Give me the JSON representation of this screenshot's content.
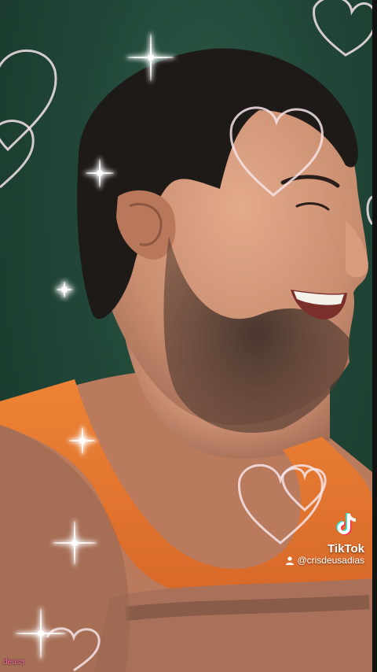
{
  "watermark": {
    "brand": "TikTok",
    "handle": "@crisdeusadias",
    "brand_icon": "tiktok-note-icon",
    "user_icon": "user-icon"
  },
  "corner_tag": "deusa",
  "colors": {
    "background": "#214637",
    "shirt": "#e8782f",
    "skin": "#c98d70",
    "hair": "#1e1a17",
    "heart_outline": "#f4e4e9",
    "corner_tag": "#ff6aa9"
  }
}
